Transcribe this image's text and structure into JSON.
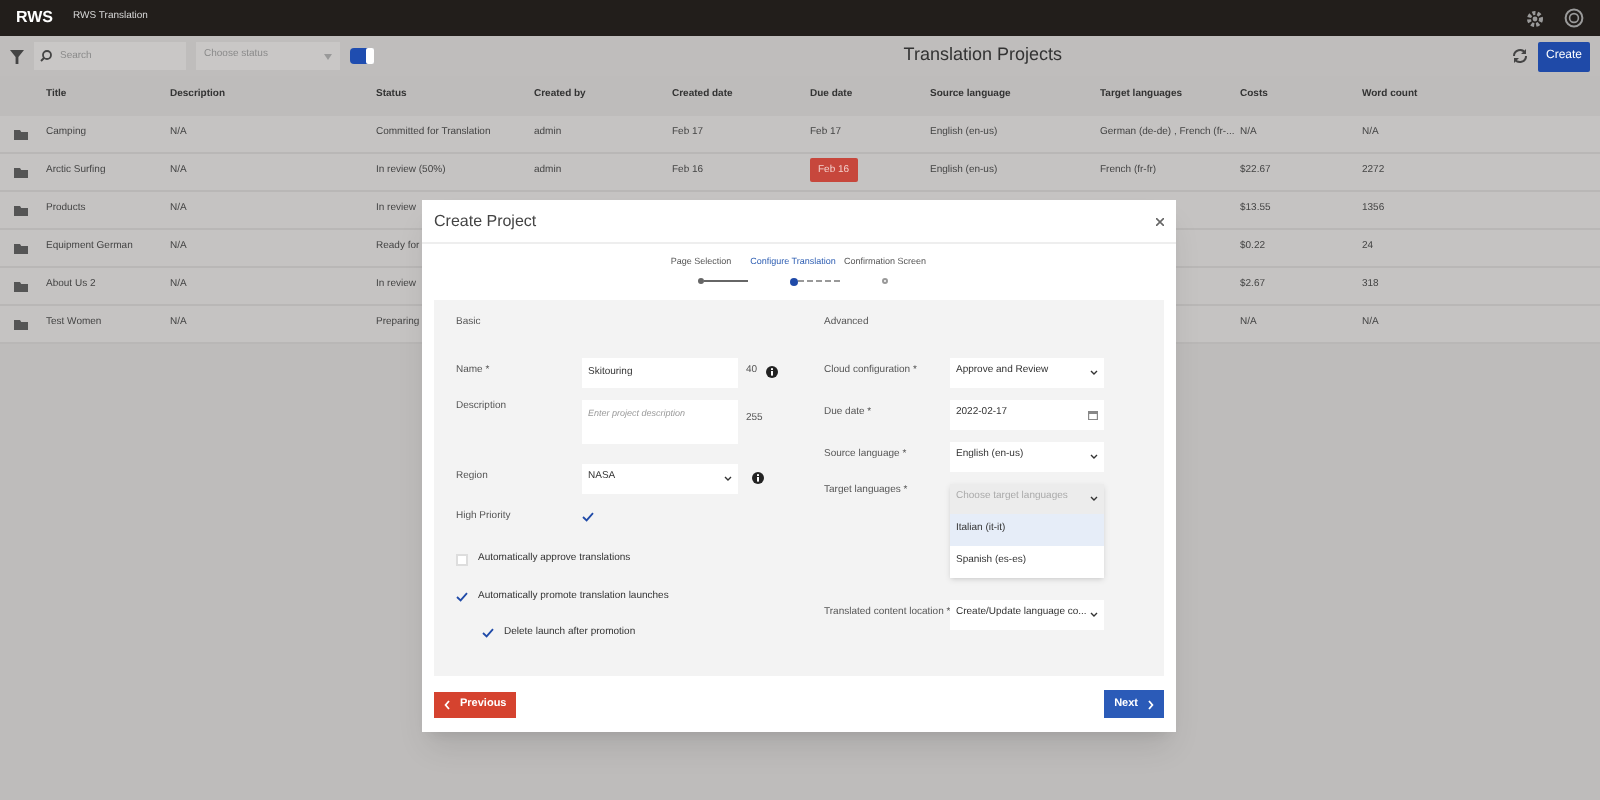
{
  "app_bar": {
    "logo": "RWS",
    "app_name": "RWS Translation"
  },
  "toolbar": {
    "search": {
      "placeholder": "Search"
    },
    "status_filter": {
      "placeholder": "Choose status"
    },
    "toggle": {
      "on": true
    },
    "title": "Translation Projects",
    "create_button": "Create"
  },
  "table": {
    "columns": [
      "Title",
      "Description",
      "Status",
      "Created by",
      "Created date",
      "Due date",
      "Source language",
      "Target languages",
      "Costs",
      "Word count"
    ],
    "rows": [
      {
        "title": "Camping",
        "description": "N/A",
        "status": "Committed for Translation",
        "created_by": "admin",
        "created_date": "Feb 17",
        "due_date": "Feb 17",
        "overdue": false,
        "source": "English (en-us)",
        "target": "German (de-de) , French (fr-...",
        "costs": "N/A",
        "word_count": "N/A"
      },
      {
        "title": "Arctic Surfing",
        "description": "N/A",
        "status": "In review (50%)",
        "created_by": "admin",
        "created_date": "Feb 16",
        "due_date": "Feb 16",
        "overdue": true,
        "source": "English (en-us)",
        "target": "French (fr-fr)",
        "costs": "$22.67",
        "word_count": "2272"
      },
      {
        "title": "Products",
        "description": "N/A",
        "status": "In review",
        "costs": "$13.55",
        "word_count": "1356"
      },
      {
        "title": "Equipment German",
        "description": "N/A",
        "status": "Ready for",
        "costs": "$0.22",
        "word_count": "24"
      },
      {
        "title": "About Us 2",
        "description": "N/A",
        "status": "In review",
        "costs": "$2.67",
        "word_count": "318"
      },
      {
        "title": "Test Women",
        "description": "N/A",
        "status": "Preparing",
        "costs": "N/A",
        "word_count": "N/A"
      }
    ]
  },
  "dialog": {
    "title": "Create Project",
    "steps": [
      {
        "label": "Page Selection",
        "selected": false,
        "completed": true
      },
      {
        "label": "Configure Translation",
        "selected": true,
        "completed": false
      },
      {
        "label": "Confirmation Screen",
        "selected": false,
        "completed": false
      }
    ],
    "basic": {
      "heading": "Basic",
      "name": {
        "label": "Name *",
        "value": "Skitouring",
        "counter": "40"
      },
      "description": {
        "label": "Description",
        "placeholder": "Enter project description",
        "counter": "255"
      },
      "region": {
        "label": "Region",
        "value": "NASA"
      },
      "high_priority": {
        "label": "High Priority",
        "checked": true
      }
    },
    "options": [
      {
        "label": "Automatically approve translations",
        "checked": false
      },
      {
        "label": "Automatically promote translation launches",
        "checked": true,
        "children": [
          {
            "label": "Delete launch after promotion",
            "checked": true
          }
        ]
      }
    ],
    "advanced": {
      "heading": "Advanced",
      "cloud_configuration": {
        "label": "Cloud configuration *",
        "value": "Approve and Review"
      },
      "due_date": {
        "label": "Due date *",
        "value": "2022-02-17"
      },
      "source_language": {
        "label": "Source language *",
        "value": "English (en-us)"
      },
      "target_languages": {
        "label": "Target languages *",
        "placeholder": "Choose target languages",
        "expanded": true,
        "options": [
          {
            "label": "Italian (it-it)",
            "highlighted": true
          },
          {
            "label": "Spanish (es-es)",
            "highlighted": false
          }
        ]
      },
      "content_location": {
        "label": "Translated content location *",
        "value": "Create/Update language co..."
      }
    },
    "previous_button": "Previous",
    "next_button": "Next"
  }
}
